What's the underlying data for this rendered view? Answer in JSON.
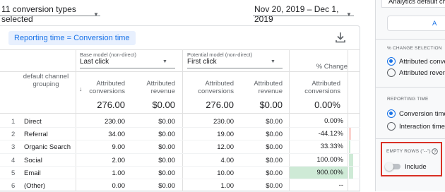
{
  "toolbar": {
    "conversion_types": "11 conversion types selected",
    "date_range": "Nov 20, 2019 – Dec 1, 2019"
  },
  "report": {
    "reporting_time_pill": "Reporting time = Conversion time",
    "base_model_label": "Base model (non-direct)",
    "base_model_value": "Last click",
    "potential_model_label": "Potential model (non-direct)",
    "potential_model_value": "First click",
    "pct_change_label": "% Change",
    "dimension_header": "default channel grouping",
    "col_headers": [
      "Attributed conversions",
      "Attributed revenue",
      "Attributed conversions",
      "Attributed revenue",
      "Attributed conversions"
    ],
    "totals": [
      "276.00",
      "$0.00",
      "276.00",
      "$0.00",
      "0.00%"
    ],
    "rows": [
      {
        "idx": "1",
        "name": "Direct",
        "c1": "230.00",
        "r1": "$0.00",
        "c2": "230.00",
        "r2": "$0.00",
        "pct": "0.00%",
        "tone": "none"
      },
      {
        "idx": "2",
        "name": "Referral",
        "c1": "34.00",
        "r1": "$0.00",
        "c2": "19.00",
        "r2": "$0.00",
        "pct": "-44.12%",
        "tone": "neg"
      },
      {
        "idx": "3",
        "name": "Organic Search",
        "c1": "9.00",
        "r1": "$0.00",
        "c2": "12.00",
        "r2": "$0.00",
        "pct": "33.33%",
        "tone": "pos"
      },
      {
        "idx": "4",
        "name": "Social",
        "c1": "2.00",
        "r1": "$0.00",
        "c2": "4.00",
        "r2": "$0.00",
        "pct": "100.00%",
        "tone": "pos"
      },
      {
        "idx": "5",
        "name": "Email",
        "c1": "1.00",
        "r1": "$0.00",
        "c2": "10.00",
        "r2": "$0.00",
        "pct": "900.00%",
        "tone": "pos"
      },
      {
        "idx": "6",
        "name": "(Other)",
        "c1": "0.00",
        "r1": "$0.00",
        "c2": "1.00",
        "r2": "$0.00",
        "pct": "--",
        "tone": "none"
      }
    ],
    "bars": [
      0,
      0.44,
      0.33,
      1.0,
      1.0,
      0
    ],
    "colors": {
      "pos": "#ceead6",
      "neg": "#fad2cf",
      "accent": "#1a73e8"
    }
  },
  "side": {
    "analytics_label": "Analytics default ch",
    "partial_button": "A",
    "pct_change_section": "% CHANGE SELECTION",
    "pct_change_options": [
      "Attributed convers",
      "Attributed revenue"
    ],
    "reporting_section": "REPORTING TIME",
    "reporting_options": [
      "Conversion time",
      "Interaction time"
    ],
    "empty_rows_section": "EMPTY ROWS (\"--\")",
    "include_label": "Include",
    "highlight_color": "#d93025"
  }
}
